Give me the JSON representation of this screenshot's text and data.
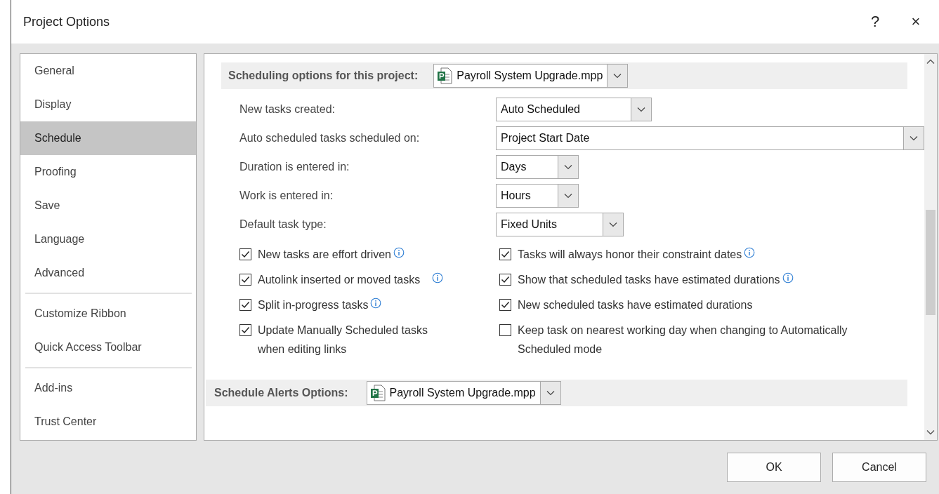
{
  "window": {
    "title": "Project Options",
    "help": "?",
    "close": "×"
  },
  "sidebar": {
    "groups": [
      [
        {
          "label": "General",
          "selected": false
        },
        {
          "label": "Display",
          "selected": false
        },
        {
          "label": "Schedule",
          "selected": true
        },
        {
          "label": "Proofing",
          "selected": false
        },
        {
          "label": "Save",
          "selected": false
        },
        {
          "label": "Language",
          "selected": false
        },
        {
          "label": "Advanced",
          "selected": false
        }
      ],
      [
        {
          "label": "Customize Ribbon",
          "selected": false
        },
        {
          "label": "Quick Access Toolbar",
          "selected": false
        }
      ],
      [
        {
          "label": "Add-ins",
          "selected": false
        },
        {
          "label": "Trust Center",
          "selected": false
        }
      ]
    ]
  },
  "scheduling_section": {
    "heading": "Scheduling options for this project:",
    "project": "Payroll System Upgrade.mpp",
    "fields": [
      {
        "label": "New tasks created:",
        "value": "Auto Scheduled"
      },
      {
        "label": "Auto scheduled tasks scheduled on:",
        "value": "Project Start Date"
      },
      {
        "label": "Duration is entered in:",
        "value": "Days"
      },
      {
        "label": "Work is entered in:",
        "value": "Hours"
      },
      {
        "label": "Default task type:",
        "value": "Fixed Units"
      }
    ],
    "left_options": [
      {
        "label": "New tasks are effort driven",
        "checked": true,
        "info": true
      },
      {
        "label": "Autolink inserted or moved tasks",
        "checked": true,
        "info": true
      },
      {
        "label": "Split in-progress tasks",
        "checked": true,
        "info": true
      },
      {
        "label": "Update Manually Scheduled tasks when editing links",
        "checked": true,
        "info": false
      }
    ],
    "right_options": [
      {
        "label": "Tasks will always honor their constraint dates",
        "checked": true,
        "info": true
      },
      {
        "label": "Show that scheduled tasks have estimated durations",
        "checked": true,
        "info": true
      },
      {
        "label": "New scheduled tasks have estimated durations",
        "checked": true,
        "info": false
      },
      {
        "label": "Keep task on nearest working day when changing to Automatically Scheduled mode",
        "checked": false,
        "info": false
      }
    ]
  },
  "alerts_section": {
    "heading": "Schedule Alerts Options:",
    "project": "Payroll System Upgrade.mpp"
  },
  "buttons": [
    "OK",
    "Cancel"
  ]
}
